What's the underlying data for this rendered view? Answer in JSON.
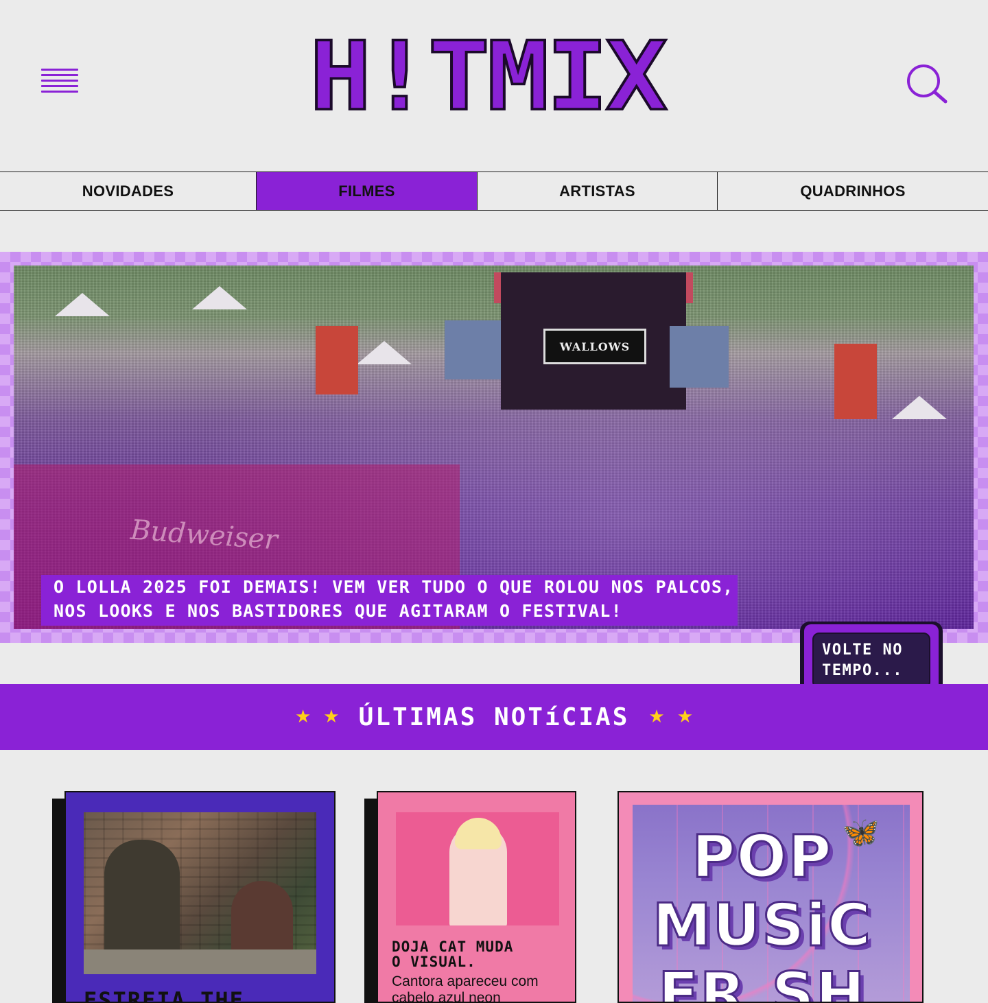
{
  "brand": {
    "logo_text": "H!TMIX",
    "accent_color": "#8a22d6",
    "icon": "pixel-logo"
  },
  "header": {
    "menu_icon": "hamburger-menu-icon",
    "search_icon": "search-icon"
  },
  "nav": {
    "tabs": [
      {
        "label": "NOVIDADES",
        "active": false
      },
      {
        "label": "FILMES",
        "active": true
      },
      {
        "label": "ARTISTAS",
        "active": false
      },
      {
        "label": "QUADRINHOS",
        "active": false
      }
    ]
  },
  "hero": {
    "caption_line1": "O LOLLA 2025 FOI DEMAIS! VEM VER TUDO O QUE ROLOU NOS PALCOS,",
    "caption_line2": "NOS LOOKS E NOS BASTIDORES QUE AGITARAM O FESTIVAL!",
    "stage_sign": "WALLOWS",
    "banner_text": "Budweiser"
  },
  "volte_button": {
    "label": "VOLTE NO\nTEMPO..."
  },
  "latest": {
    "title": "ÚLTIMAS NOTíCIAS",
    "star_color": "#ffd01a"
  },
  "cards": [
    {
      "title": "ESTREIA THE"
    },
    {
      "title": "DOJA CAT MUDA\nO VISUAL.",
      "desc": "Cantora apareceu com cabelo azul neon"
    },
    {
      "poster": "POP\nMUSiC\nFR.SH"
    }
  ]
}
